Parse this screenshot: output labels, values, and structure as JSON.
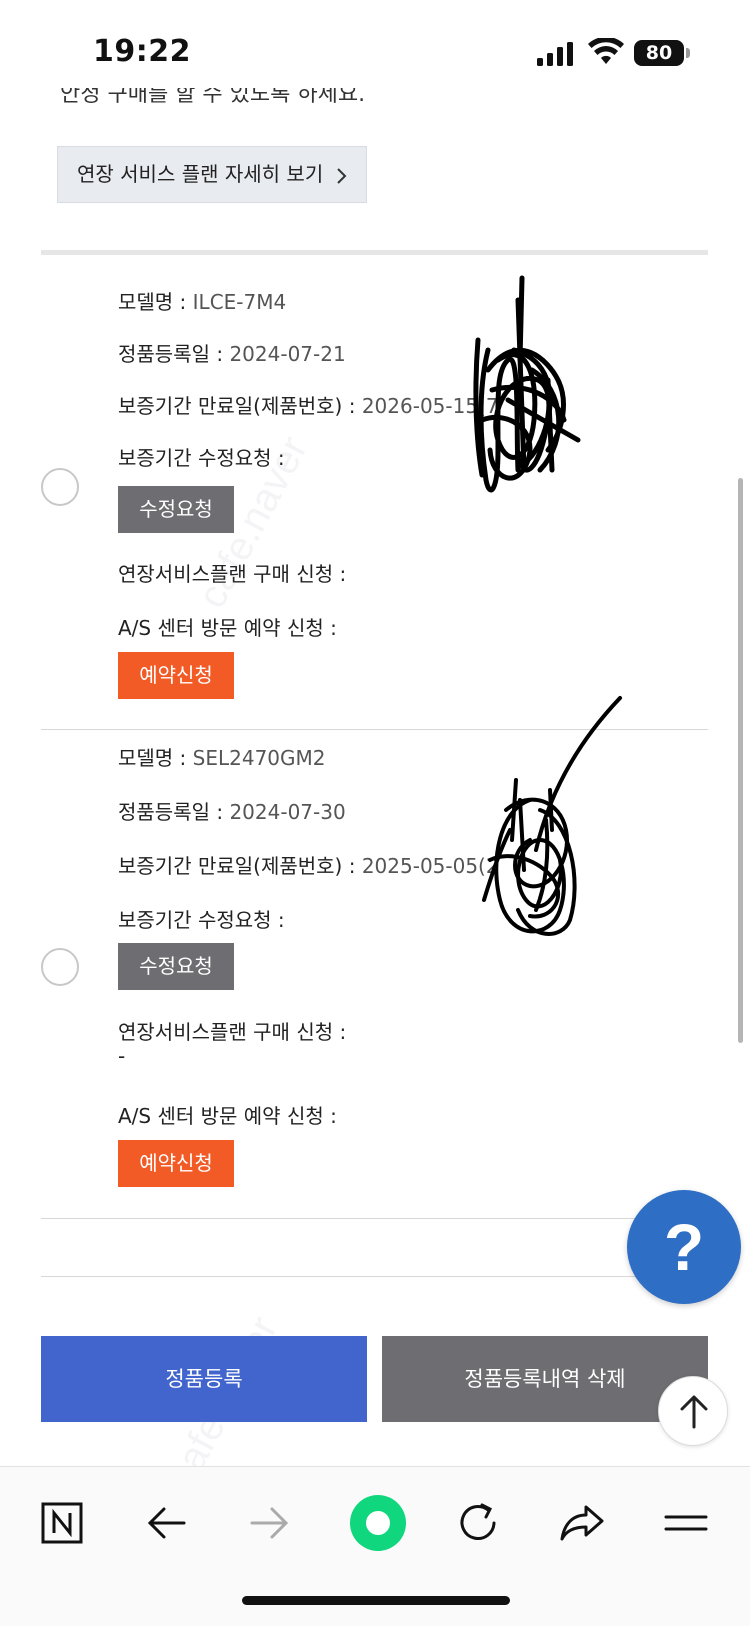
{
  "status_bar": {
    "time": "19:22",
    "battery": "80"
  },
  "top_text_cut": "안정 구매를 할 수 있도록 하세요.",
  "extend_plan_button": "연장 서비스 플랜 자세히 보기",
  "products": [
    {
      "model_label": "모델명 : ",
      "model": "ILCE-7M4",
      "reg_label": "정품등록일 : ",
      "reg_date": "2024-07-21",
      "warranty_label": "보증기간 만료일(제품번호) : ",
      "warranty_value": "2026-05-15(7",
      "modify_label": "보증기간 수정요청 :",
      "modify_button": "수정요청",
      "plan_label": "연장서비스플랜 구매 신청 :",
      "plan_value": "",
      "as_label": "A/S 센터 방문 예약 신청 :",
      "as_button": "예약신청"
    },
    {
      "model_label": "모델명 : ",
      "model": "SEL2470GM2",
      "reg_label": "정품등록일 : ",
      "reg_date": "2024-07-30",
      "warranty_label": "보증기간 만료일(제품번호) : ",
      "warranty_value": "2025-05-05(2",
      "modify_label": "보증기간 수정요청 :",
      "modify_button": "수정요청",
      "plan_label": "연장서비스플랜 구매 신청 :",
      "plan_value": "-",
      "as_label": "A/S 센터 방문 예약 신청 :",
      "as_button": "예약신청"
    }
  ],
  "help_button": "?",
  "register_button": "정품등록",
  "delete_button": "정품등록내역 삭제",
  "watermark": "cafe.naver"
}
